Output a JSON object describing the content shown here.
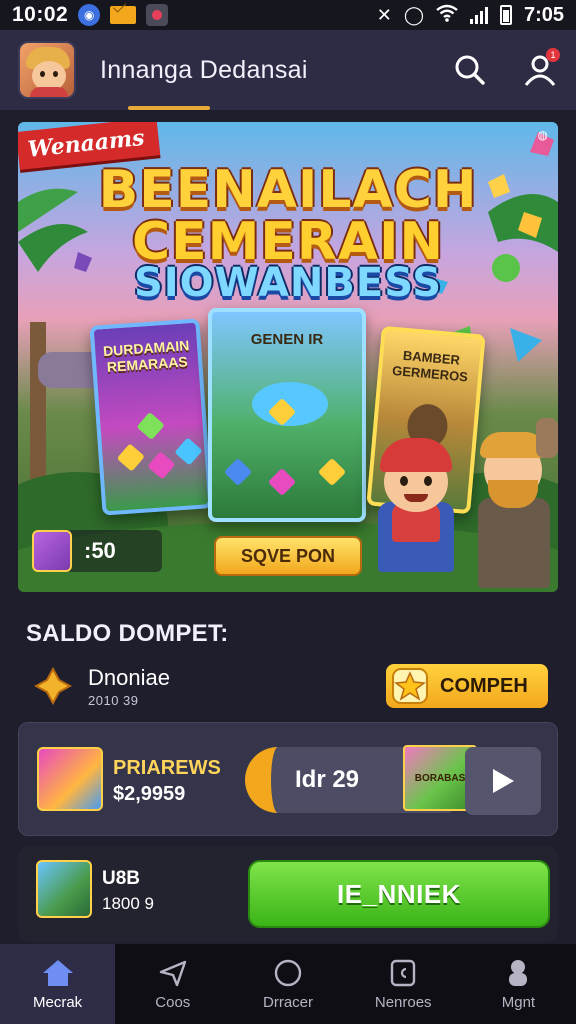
{
  "status_bar": {
    "time_left": "10:02",
    "time_right": "7:05"
  },
  "header": {
    "title": "Innanga Dedansai",
    "notification_badge": "1"
  },
  "banner": {
    "ribbon": "Wenaams",
    "headline_1": "BEENAILACH",
    "headline_2": "CEMERAIN",
    "headline_3": "SIOWANBESS",
    "card_left_label": "DURDAMAIN REMARAAS",
    "card_mid_label": "GENEN IR",
    "card_right_label": "BAMBER GERMEROS",
    "count": ":50",
    "cta": "SQVE PON"
  },
  "wallet": {
    "section_title": "SALDO DOMPET:",
    "balance_name": "Dnoniae",
    "balance_sub": "2010 39",
    "balance_button": "COMPEH"
  },
  "offer": {
    "name": "PRIAREWS",
    "price": "$2,9959",
    "pill_text": "Idr 29",
    "pill_thumb_label": "BORABAS"
  },
  "promo": {
    "name": "U8B",
    "sub": "1800 9",
    "button": "IE_NNIEK"
  },
  "bottom_nav": [
    {
      "label": "Mecrak",
      "icon": "home-icon"
    },
    {
      "label": "Coos",
      "icon": "send-icon"
    },
    {
      "label": "Drracer",
      "icon": "circle-icon"
    },
    {
      "label": "Nenroes",
      "icon": "wallet-icon"
    },
    {
      "label": "Mgnt",
      "icon": "user-icon"
    }
  ],
  "colors": {
    "background": "#1e1e2c",
    "header": "#2e2c44",
    "accent_gold": "#f2a71c",
    "accent_green": "#3bb418"
  }
}
